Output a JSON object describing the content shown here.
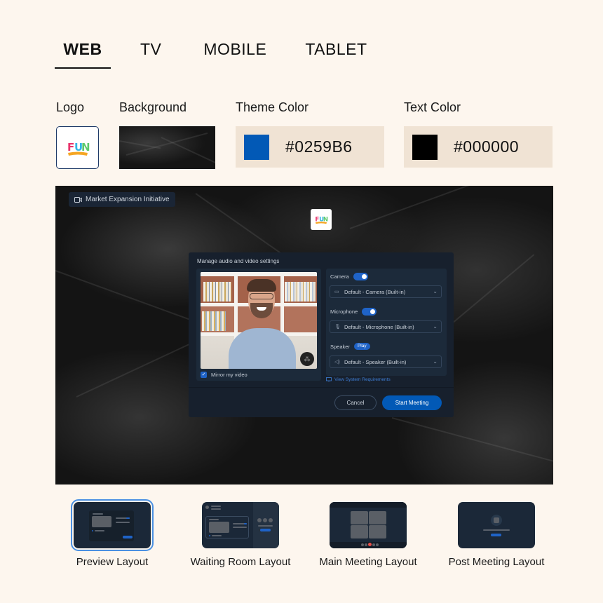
{
  "tabs": [
    {
      "label": "WEB",
      "active": true
    },
    {
      "label": "TV",
      "active": false
    },
    {
      "label": "MOBILE",
      "active": false
    },
    {
      "label": "TABLET",
      "active": false
    }
  ],
  "settings": {
    "logo_label": "Logo",
    "logo_text": "FUN",
    "background_label": "Background",
    "theme_color_label": "Theme Color",
    "theme_color_value": "#0259B6",
    "text_color_label": "Text Color",
    "text_color_value": "#000000"
  },
  "preview": {
    "meeting_title": "Market Expansion Initiative",
    "logo_text": "FUN",
    "dialog": {
      "title": "Manage audio and video settings",
      "mirror_label": "Mirror my video",
      "mirror_checked": true,
      "camera_label": "Camera",
      "camera_on": true,
      "camera_device": "Default - Camera (Built-in)",
      "microphone_label": "Microphone",
      "microphone_on": true,
      "microphone_device": "Default - Microphone (Built-in)",
      "speaker_label": "Speaker",
      "play_label": "Play",
      "speaker_device": "Default - Speaker (Built-in)",
      "system_requirements_link": "View System Requirements",
      "cancel_label": "Cancel",
      "start_label": "Start Meeting"
    }
  },
  "layouts": [
    {
      "label": "Preview Layout",
      "selected": true
    },
    {
      "label": "Waiting Room Layout",
      "selected": false
    },
    {
      "label": "Main Meeting Layout",
      "selected": false
    },
    {
      "label": "Post Meeting Layout",
      "selected": false
    }
  ],
  "colors": {
    "theme": "#0259B6",
    "text": "#000000",
    "page_bg": "#FDF6EE",
    "field_bg": "#F0E3D4"
  }
}
